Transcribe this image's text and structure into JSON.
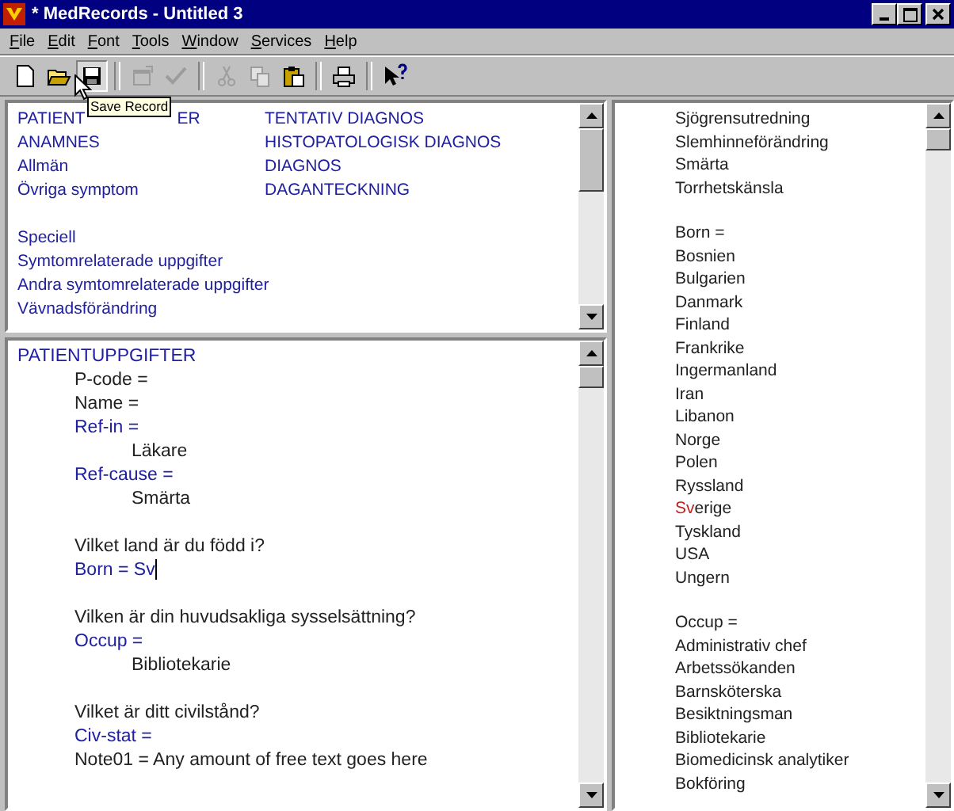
{
  "window": {
    "title": "* MedRecords - Untitled 3"
  },
  "menu": [
    "File",
    "Edit",
    "Font",
    "Tools",
    "Window",
    "Services",
    "Help"
  ],
  "toolbar": [
    {
      "kind": "new",
      "disabled": false,
      "pressed": false
    },
    {
      "kind": "open",
      "disabled": false,
      "pressed": false
    },
    {
      "kind": "save",
      "disabled": false,
      "pressed": true
    },
    {
      "kind": "sep"
    },
    {
      "kind": "properties",
      "disabled": true,
      "pressed": false
    },
    {
      "kind": "check",
      "disabled": true,
      "pressed": false
    },
    {
      "kind": "sep"
    },
    {
      "kind": "cut",
      "disabled": true,
      "pressed": false
    },
    {
      "kind": "copy",
      "disabled": true,
      "pressed": false
    },
    {
      "kind": "paste",
      "disabled": false,
      "pressed": false
    },
    {
      "kind": "sep"
    },
    {
      "kind": "print",
      "disabled": false,
      "pressed": false
    },
    {
      "kind": "sep"
    },
    {
      "kind": "help",
      "disabled": false,
      "pressed": false
    }
  ],
  "tooltip": "Save Record",
  "sections": [
    {
      "rows": [
        [
          [
            "PATIENT",
            "ER"
          ],
          "TENTATIV DIAGNOS"
        ],
        [
          "ANAMNES",
          "HISTOPATOLOGISK DIAGNOS"
        ],
        [
          "Allmän",
          "DIAGNOS"
        ],
        [
          "Övriga symptom",
          "DAGANTECKNING"
        ]
      ]
    },
    {
      "rows": [
        [
          "Speciell"
        ],
        [
          "Symtomrelaterade uppgifter"
        ],
        [
          "Andra symtomrelaterade uppgifter"
        ],
        [
          "Vävnadsförändring"
        ]
      ]
    }
  ],
  "document": [
    {
      "kind": "heading",
      "text": "PATIENTUPPGIFTER"
    },
    {
      "kind": "plain",
      "text": "P-code ="
    },
    {
      "kind": "plain",
      "text": "Name ="
    },
    {
      "kind": "field",
      "text": "Ref-in ="
    },
    {
      "kind": "value",
      "text": "Läkare"
    },
    {
      "kind": "field",
      "text": "Ref-cause ="
    },
    {
      "kind": "value",
      "text": "Smärta"
    },
    {
      "kind": "blank"
    },
    {
      "kind": "plain",
      "text": "Vilket land är du född i?"
    },
    {
      "kind": "field",
      "text": "Born = Sv",
      "caret": true
    },
    {
      "kind": "blank"
    },
    {
      "kind": "plain",
      "text": "Vilken är din huvudsakliga sysselsättning?"
    },
    {
      "kind": "field",
      "text": "Occup ="
    },
    {
      "kind": "value",
      "text": "Bibliotekarie"
    },
    {
      "kind": "blank"
    },
    {
      "kind": "plain",
      "text": "Vilket är ditt civilstånd?"
    },
    {
      "kind": "field",
      "text": "Civ-stat ="
    },
    {
      "kind": "plain",
      "text": "Note01 = Any amount of free text goes here"
    }
  ],
  "choices": [
    [
      {
        "text": "Sjögrensutredning"
      },
      {
        "text": "Slemhinneförändring"
      },
      {
        "text": "Smärta"
      },
      {
        "text": "Torrhetskänsla"
      }
    ],
    [
      {
        "text": "Born ="
      },
      {
        "text": "Bosnien"
      },
      {
        "text": "Bulgarien"
      },
      {
        "text": "Danmark"
      },
      {
        "text": "Finland"
      },
      {
        "text": "Frankrike"
      },
      {
        "text": "Ingermanland"
      },
      {
        "text": "Iran"
      },
      {
        "text": "Libanon"
      },
      {
        "text": "Norge"
      },
      {
        "text": "Polen"
      },
      {
        "text": "Ryssland"
      },
      {
        "typed": "Sv",
        "text": "erige"
      },
      {
        "text": "Tyskland"
      },
      {
        "text": "USA"
      },
      {
        "text": "Ungern"
      }
    ],
    [
      {
        "text": "Occup ="
      },
      {
        "text": "Administrativ chef"
      },
      {
        "text": "Arbetssökanden"
      },
      {
        "text": "Barnsköterska"
      },
      {
        "text": "Besiktningsman"
      },
      {
        "text": "Bibliotekarie"
      },
      {
        "text": "Biomedicinsk analytiker"
      },
      {
        "text": "Bokföring"
      }
    ]
  ]
}
